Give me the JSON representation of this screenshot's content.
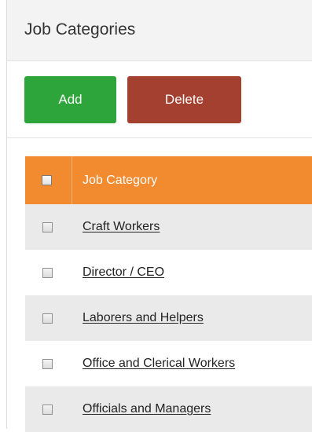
{
  "panel": {
    "title": "Job Categories"
  },
  "toolbar": {
    "add_label": "Add",
    "delete_label": "Delete"
  },
  "table": {
    "column_header": "Job Category",
    "rows": [
      "Craft Workers",
      "Director / CEO",
      "Laborers and Helpers",
      "Office and Clerical Workers",
      "Officials and Managers"
    ]
  },
  "colors": {
    "add_button": "#2da53a",
    "delete_button": "#a3402f",
    "table_header": "#f28a30"
  }
}
